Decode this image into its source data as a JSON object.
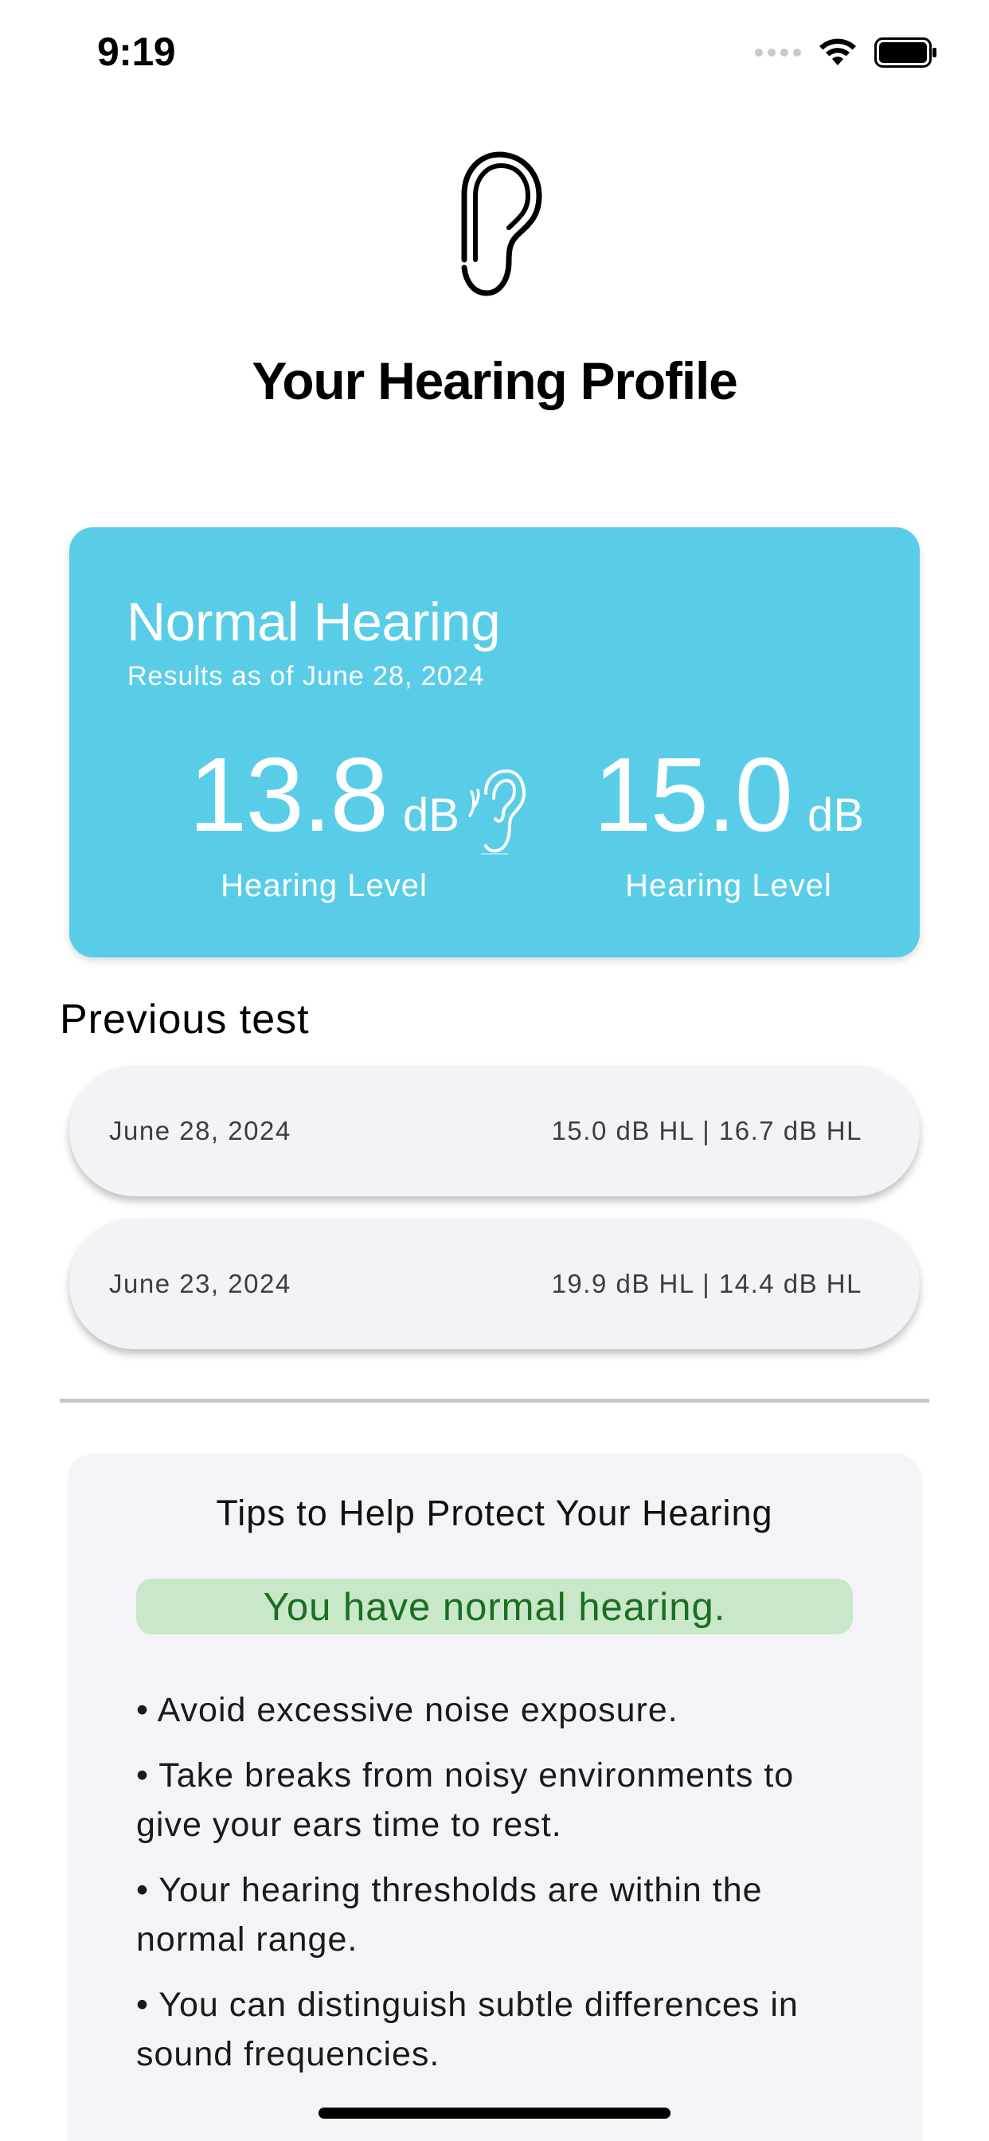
{
  "status_bar": {
    "time": "9:19"
  },
  "header": {
    "title": "Your Hearing Profile",
    "logo_icon": "ear-icon"
  },
  "summary": {
    "status": "Normal Hearing",
    "date_text": "Results as of June 28, 2024",
    "left": {
      "value": "13.8",
      "unit": "dB",
      "label": "Hearing Level"
    },
    "right": {
      "value": "15.0",
      "unit": "dB",
      "label": "Hearing Level"
    },
    "background_color": "#59cde7"
  },
  "previous_tests": {
    "title": "Previous test",
    "items": [
      {
        "date": "June 28, 2024",
        "values": "15.0 dB HL | 16.7 dB HL"
      },
      {
        "date": "June 23, 2024",
        "values": "19.9 dB HL | 14.4 dB HL"
      }
    ]
  },
  "tips": {
    "title": "Tips to Help Protect Your Hearing",
    "badge": "You have normal hearing.",
    "badge_color": "#c9e7c9",
    "items": [
      "• Avoid excessive noise exposure.",
      "• Take breaks from noisy environments to give your ears time to rest.",
      "• Your hearing thresholds are within the normal range.",
      "• You can distinguish subtle differences in sound frequencies."
    ]
  }
}
